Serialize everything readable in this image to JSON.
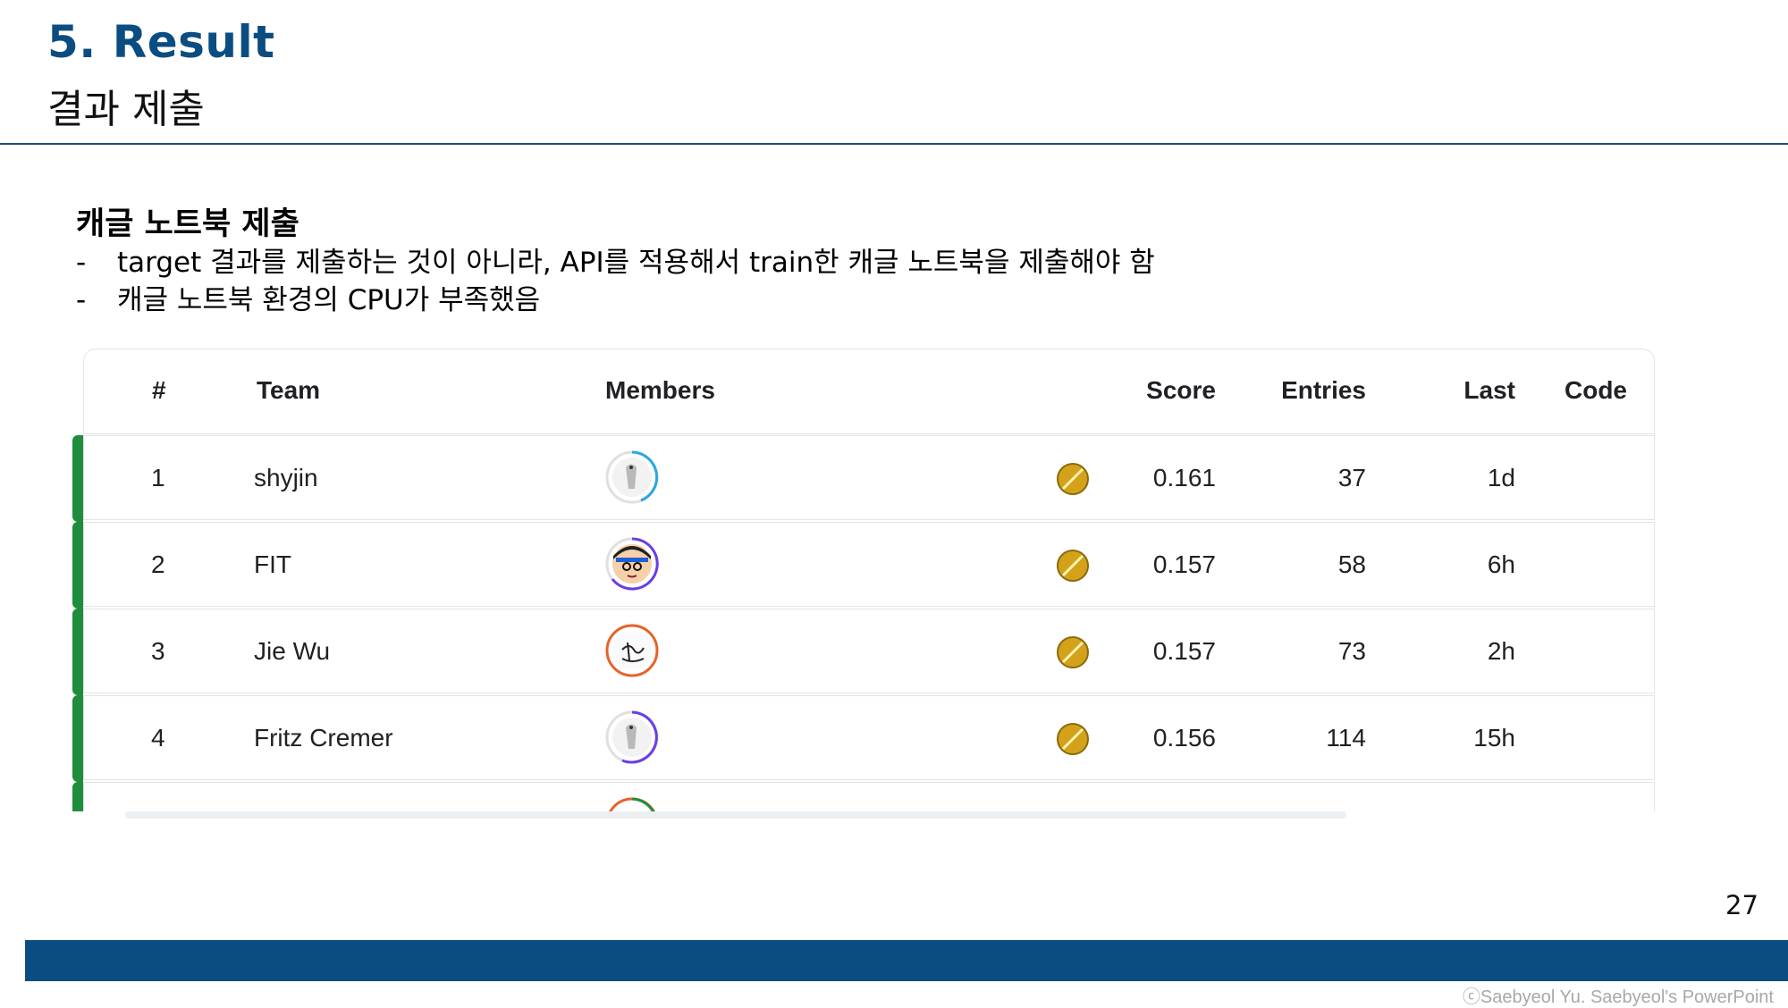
{
  "slide": {
    "title": "5. Result",
    "subtitle": "결과 제출",
    "section_title": "캐글 노트북 제출",
    "bullets": [
      "target 결과를 제출하는 것이 아니라, API를 적용해서 train한 캐글 노트북을 제출해야 함",
      "캐글 노트북 환경의 CPU가 부족했음"
    ],
    "bullet_marker": "-",
    "page_number": "27",
    "copyright": "ⓒSaebyeol Yu. Saebyeol's PowerPoint",
    "colors": {
      "title": "#0b4d80",
      "footer_bar": "#0b4d80",
      "row_accent": "#1e8e3e",
      "medal": "#d4a21a"
    }
  },
  "leaderboard": {
    "headers": {
      "rank": "#",
      "team": "Team",
      "members": "Members",
      "score": "Score",
      "entries": "Entries",
      "last": "Last",
      "code": "Code"
    },
    "rows": [
      {
        "rank": "1",
        "team": "shyjin",
        "avatar_icon": "goose-avatar-icon",
        "score": "0.161",
        "entries": "37",
        "last": "1d"
      },
      {
        "rank": "2",
        "team": "FIT",
        "avatar_icon": "cartoon-face-avatar-icon",
        "score": "0.157",
        "entries": "58",
        "last": "6h"
      },
      {
        "rank": "3",
        "team": "Jie Wu",
        "avatar_icon": "calligraphy-avatar-icon",
        "score": "0.157",
        "entries": "73",
        "last": "2h"
      },
      {
        "rank": "4",
        "team": "Fritz Cremer",
        "avatar_icon": "goose-avatar-icon",
        "score": "0.156",
        "entries": "114",
        "last": "15h"
      }
    ]
  }
}
